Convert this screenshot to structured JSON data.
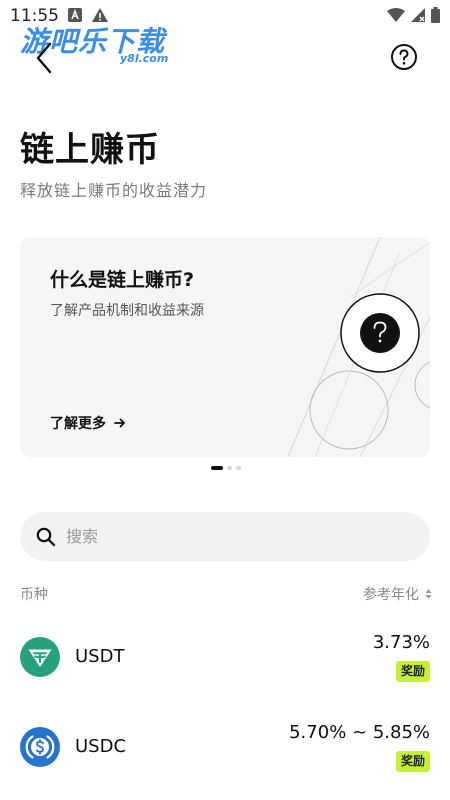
{
  "status_bar": {
    "time": "11:55"
  },
  "watermark": {
    "main": "游吧乐下载",
    "sub": "y8l.com"
  },
  "header": {
    "title": "链上赚币",
    "subtitle": "释放链上赚币的收益潜力"
  },
  "banner": {
    "title": "什么是链上赚币?",
    "description": "了解产品机制和收益来源",
    "link_label": "了解更多",
    "page_count": 3,
    "active_page": 1
  },
  "search": {
    "placeholder": "搜索"
  },
  "list_header": {
    "coin_label": "币种",
    "apr_label": "参考年化"
  },
  "coins": [
    {
      "symbol": "USDT",
      "rate": "3.73%",
      "badge": "奖励",
      "logo_color": "#26a17b",
      "icon": "tether-icon"
    },
    {
      "symbol": "USDC",
      "rate": "5.70% ~ 5.85%",
      "badge": "奖励",
      "logo_color": "#2775ca",
      "icon": "usd-coin-icon"
    }
  ],
  "colors": {
    "accent_badge": "#c5f03a",
    "watermark_blue": "#3a8ee6"
  }
}
